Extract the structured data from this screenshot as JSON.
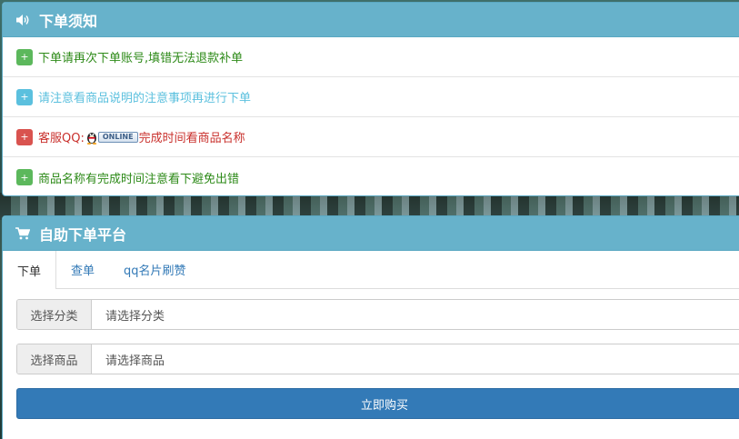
{
  "notice": {
    "title": "下单须知",
    "items": [
      {
        "text": "下单请再次下单账号,填错无法退款补单",
        "color": "green"
      },
      {
        "text": "请注意看商品说明的注意事项再进行下单",
        "color": "blue"
      },
      {
        "pre": "客服QQ:",
        "badge": "ONLINE",
        "post": "完成时间看商品名称",
        "color": "red"
      },
      {
        "text": "商品名称有完成时间注意看下避免出错",
        "color": "green"
      }
    ],
    "plus_symbol": "+"
  },
  "order": {
    "title": "自助下单平台",
    "tabs": [
      "下单",
      "查单",
      "qq名片刷赞"
    ],
    "category_label": "选择分类",
    "category_value": "请选择分类",
    "product_label": "选择商品",
    "product_value": "请选择商品",
    "buy_label": "立即购买"
  },
  "icons": {
    "notice": "volume-icon",
    "order": "cart-icon",
    "qq": "qq-penguin-icon"
  },
  "colors": {
    "heading": "#67b2cb",
    "green": "#5cb85c",
    "blue": "#5bc0de",
    "red": "#d9534f",
    "primary": "#337ab7"
  }
}
